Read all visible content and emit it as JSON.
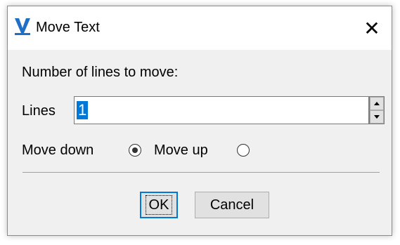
{
  "window": {
    "title": "Move Text",
    "app_icon": "vsnCAD-logo-icon",
    "close_glyph": "✕"
  },
  "form": {
    "heading": "Number of lines to move:",
    "lines_label": "Lines",
    "lines_value": "1",
    "move_down_label": "Move down",
    "move_up_label": "Move up",
    "selected_direction": "down"
  },
  "buttons": {
    "ok": "OK",
    "cancel": "Cancel"
  },
  "colors": {
    "accent": "#0078d7",
    "dialog_bg": "#f0f0f0"
  }
}
